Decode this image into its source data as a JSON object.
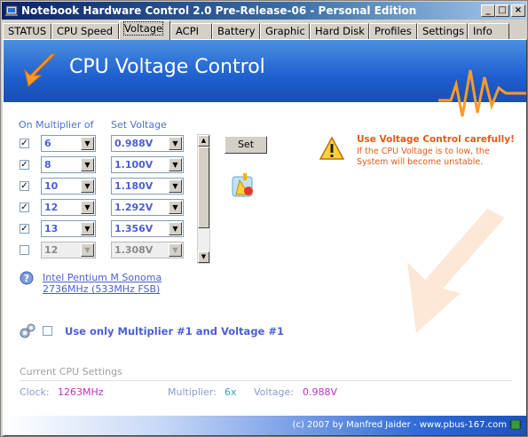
{
  "window": {
    "title": "Notebook Hardware Control 2.0 Pre-Release-06 - Personal Edition",
    "controls": {
      "minimize": "_",
      "maximize": "□",
      "close": "×"
    }
  },
  "tabs": [
    "STATUS",
    "CPU Speed",
    "Voltage",
    "ACPI",
    "Battery",
    "Graphic",
    "Hard Disk",
    "Profiles",
    "Settings",
    "Info"
  ],
  "active_tab": "Voltage",
  "banner": {
    "title": "CPU Voltage Control"
  },
  "table": {
    "col_multiplier": "On Multiplier of",
    "col_voltage": "Set Voltage",
    "rows": [
      {
        "checked": true,
        "multiplier": "6",
        "voltage": "0.988V",
        "enabled": true
      },
      {
        "checked": true,
        "multiplier": "8",
        "voltage": "1.100V",
        "enabled": true
      },
      {
        "checked": true,
        "multiplier": "10",
        "voltage": "1.180V",
        "enabled": true
      },
      {
        "checked": true,
        "multiplier": "12",
        "voltage": "1.292V",
        "enabled": true
      },
      {
        "checked": true,
        "multiplier": "13",
        "voltage": "1.356V",
        "enabled": true
      },
      {
        "checked": false,
        "multiplier": "12",
        "voltage": "1.308V",
        "enabled": false
      }
    ]
  },
  "set_button": "Set",
  "warning": {
    "title": "Use Voltage Control carefully!",
    "text": "If the CPU Voltage is to low, the System will become unstable."
  },
  "cpu": {
    "name": "Intel Pentium M Sonoma",
    "freq": "2736MHz (533MHz FSB)"
  },
  "only_first": {
    "checked": false,
    "label": "Use only Multiplier #1 and Voltage #1"
  },
  "current": {
    "title": "Current CPU Settings",
    "clock_label": "Clock:",
    "clock_value": "1263MHz",
    "multiplier_label": "Multiplier:",
    "multiplier_value": "6x",
    "voltage_label": "Voltage:",
    "voltage_value": "0.988V"
  },
  "footer": {
    "text": "(c) 2007 by Manfred Jaider - www.pbus-167.com"
  },
  "icons": {
    "window": "app-icon",
    "banner": "orange-arrow-icon",
    "warning": "warning-triangle-icon",
    "help": "help-question-icon",
    "settings": "gears-icon",
    "apply": "apply-voltage-icon",
    "chip": "chip-icon"
  },
  "colors": {
    "accent_blue": "#1e5fcf",
    "value_blue": "#4a5fd4",
    "warning_orange": "#e35a1a",
    "clock_purple": "#c030c0",
    "multiplier_teal": "#3aa0c0"
  }
}
